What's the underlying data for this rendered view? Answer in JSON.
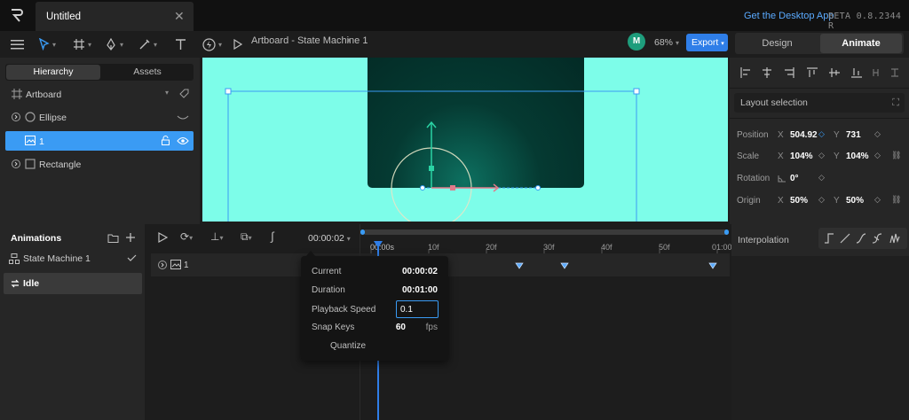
{
  "tab": {
    "title": "Untitled",
    "close": "✕"
  },
  "header": {
    "desktop_link": "Get the Desktop App",
    "beta": "BETA 0.8.2344 R"
  },
  "toolbar": {
    "breadcrumb": "Artboard - State Machine 1",
    "avatar": "M",
    "zoom": "68%",
    "export": "Export",
    "design_tab": "Design",
    "animate_tab": "Animate"
  },
  "hierarchy": {
    "tab_hierarchy": "Hierarchy",
    "tab_assets": "Assets",
    "items": [
      {
        "label": "Artboard"
      },
      {
        "label": "Ellipse"
      },
      {
        "label": "1"
      },
      {
        "label": "Rectangle"
      }
    ]
  },
  "inspector": {
    "layout_selection": "Layout selection",
    "position": {
      "label": "Position",
      "x_axis": "X",
      "x": "504.92",
      "y_axis": "Y",
      "y": "731"
    },
    "scale": {
      "label": "Scale",
      "x_axis": "X",
      "x": "104%",
      "y_axis": "Y",
      "y": "104%"
    },
    "rotation": {
      "label": "Rotation",
      "value": "0°"
    },
    "origin": {
      "label": "Origin",
      "x_axis": "X",
      "x": "50%",
      "y_axis": "Y",
      "y": "50%"
    }
  },
  "animations": {
    "title": "Animations",
    "state_machine": "State Machine 1",
    "idle": "Idle"
  },
  "timeline": {
    "time_display": "00:00:02",
    "ruler_ticks": [
      "00:00s",
      "10f",
      "20f",
      "30f",
      "40f",
      "50f",
      "01:00"
    ],
    "track_label": "1"
  },
  "popup": {
    "current_label": "Current",
    "current_value": "00:00:02",
    "duration_label": "Duration",
    "duration_value": "00:01:00",
    "speed_label": "Playback Speed",
    "speed_value": "0.1",
    "snap_label": "Snap Keys",
    "snap_value": "60",
    "snap_unit": "fps",
    "quantize": "Quantize"
  },
  "interpolation": {
    "title": "Interpolation"
  },
  "colors": {
    "accent": "#3a9bf4",
    "canvas": "#7dfde9",
    "avatar": "#1e9d7c"
  }
}
